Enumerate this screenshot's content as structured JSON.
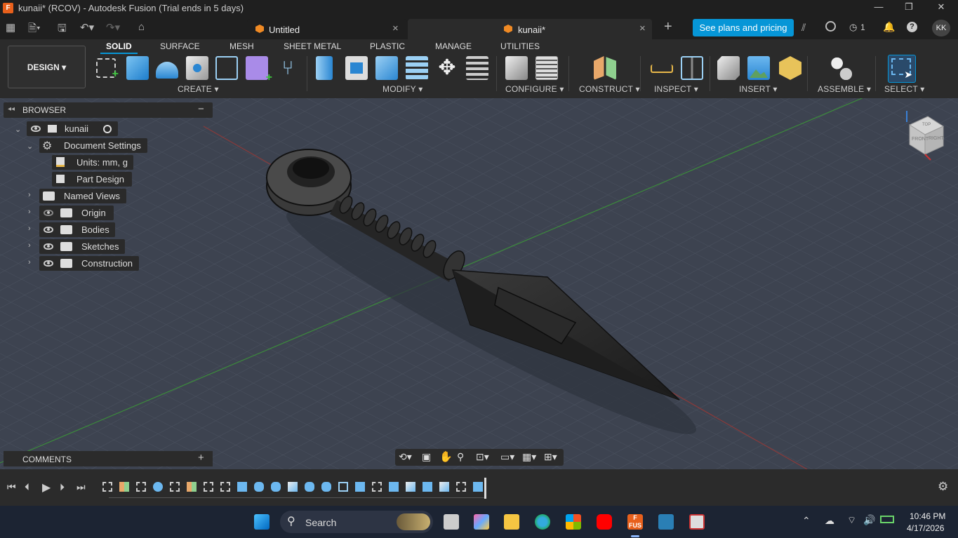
{
  "titlebar": {
    "title": "kunaii* (RCOV) - Autodesk Fusion (Trial ends in 5 days)",
    "app_icon": "F"
  },
  "tabs": {
    "untitled": "Untitled",
    "kunaii": "kunaii*",
    "plans": "See plans and pricing",
    "jobs_count": "1",
    "user_initials": "KK"
  },
  "ribbon": {
    "design": "DESIGN",
    "tabs": [
      "SOLID",
      "SURFACE",
      "MESH",
      "SHEET METAL",
      "PLASTIC",
      "MANAGE",
      "UTILITIES"
    ],
    "groups": {
      "create": "CREATE",
      "modify": "MODIFY",
      "configure": "CONFIGURE",
      "construct": "CONSTRUCT",
      "inspect": "INSPECT",
      "insert": "INSERT",
      "assemble": "ASSEMBLE",
      "select": "SELECT"
    }
  },
  "browser": {
    "header": "BROWSER",
    "root": "kunaii",
    "items": [
      "Document Settings",
      "Units: mm, g",
      "Part Design",
      "Named Views",
      "Origin",
      "Bodies",
      "Sketches",
      "Construction"
    ]
  },
  "comments": {
    "header": "COMMENTS"
  },
  "viewcube": {
    "front": "FRONT",
    "right": "RIGHT",
    "top": "TOP"
  },
  "taskbar": {
    "search": "Search",
    "time": "10:46 PM",
    "date": "4/17/2026",
    "fusion_label": "FUS"
  },
  "colors": {
    "accent": "#0696d7",
    "ribbon_bg": "#2b2b2b",
    "viewport_bg": "#3d4350",
    "taskbar_bg": "#1c2433",
    "brand_orange": "#e8601c"
  }
}
